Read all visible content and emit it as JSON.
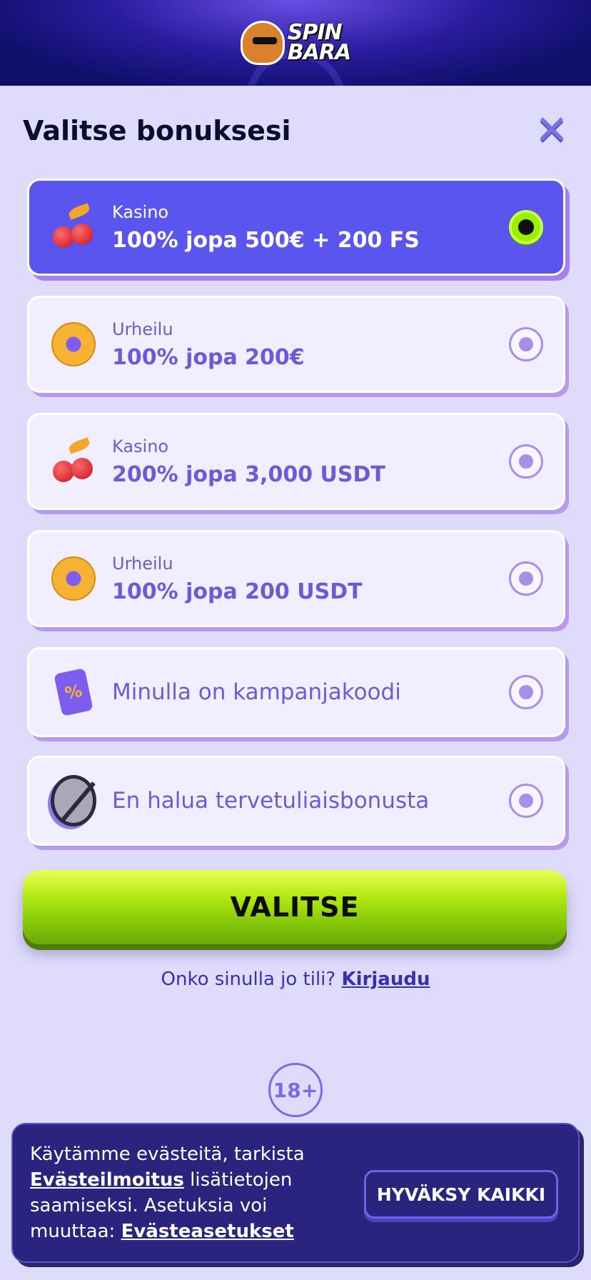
{
  "header": {
    "logo_line1": "SPIN",
    "logo_line2": "BARA"
  },
  "modal": {
    "title": "Valitse bonuksesi",
    "close_icon": "close-icon"
  },
  "options": [
    {
      "category": "Kasino",
      "bonus": "100% jopa 500€ + 200 FS",
      "icon": "cherry-icon",
      "selected": true
    },
    {
      "category": "Urheilu",
      "bonus": "100% jopa 200€",
      "icon": "football-icon",
      "selected": false
    },
    {
      "category": "Kasino",
      "bonus": "200% jopa 3,000 USDT",
      "icon": "cherry-icon",
      "selected": false
    },
    {
      "category": "Urheilu",
      "bonus": "100% jopa 200 USDT",
      "icon": "football-icon",
      "selected": false
    },
    {
      "label": "Minulla on kampanjakoodi",
      "icon": "ticket-icon",
      "selected": false
    },
    {
      "label": "En halua tervetuliaisbonusta",
      "icon": "no-sign-icon",
      "selected": false
    }
  ],
  "select_button": "VALITSE",
  "login": {
    "prompt": "Onko sinulla jo tili?",
    "link": "Kirjaudu"
  },
  "age_badge": "18+",
  "cookie": {
    "text_1": "Käytämme evästeitä, tarkista",
    "link_1": "Evästeilmoitus",
    "text_2": "lisätietojen saamiseksi. Asetuksia voi muuttaa:",
    "link_2": "Evästeasetukset",
    "accept_button": "HYVÄKSY KAIKKI"
  },
  "colors": {
    "accent": "#5a55ee",
    "cta": "#b4ea12",
    "cookie_bg": "#2b247e"
  }
}
